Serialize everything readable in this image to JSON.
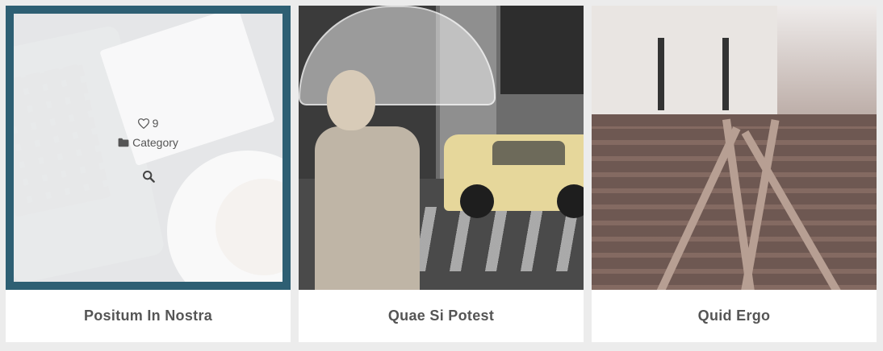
{
  "portfolio": {
    "items": [
      {
        "title": "Positum In Nostra",
        "likes": "9",
        "category": "Category",
        "hovered": true
      },
      {
        "title": "Quae Si Potest"
      },
      {
        "title": "Quid Ergo"
      }
    ]
  },
  "colors": {
    "frame": "#2e5f73",
    "title_text": "#555555",
    "background": "#ececec"
  },
  "icons": {
    "likes": "heart-icon",
    "category": "folder-icon",
    "zoom": "search-icon"
  }
}
